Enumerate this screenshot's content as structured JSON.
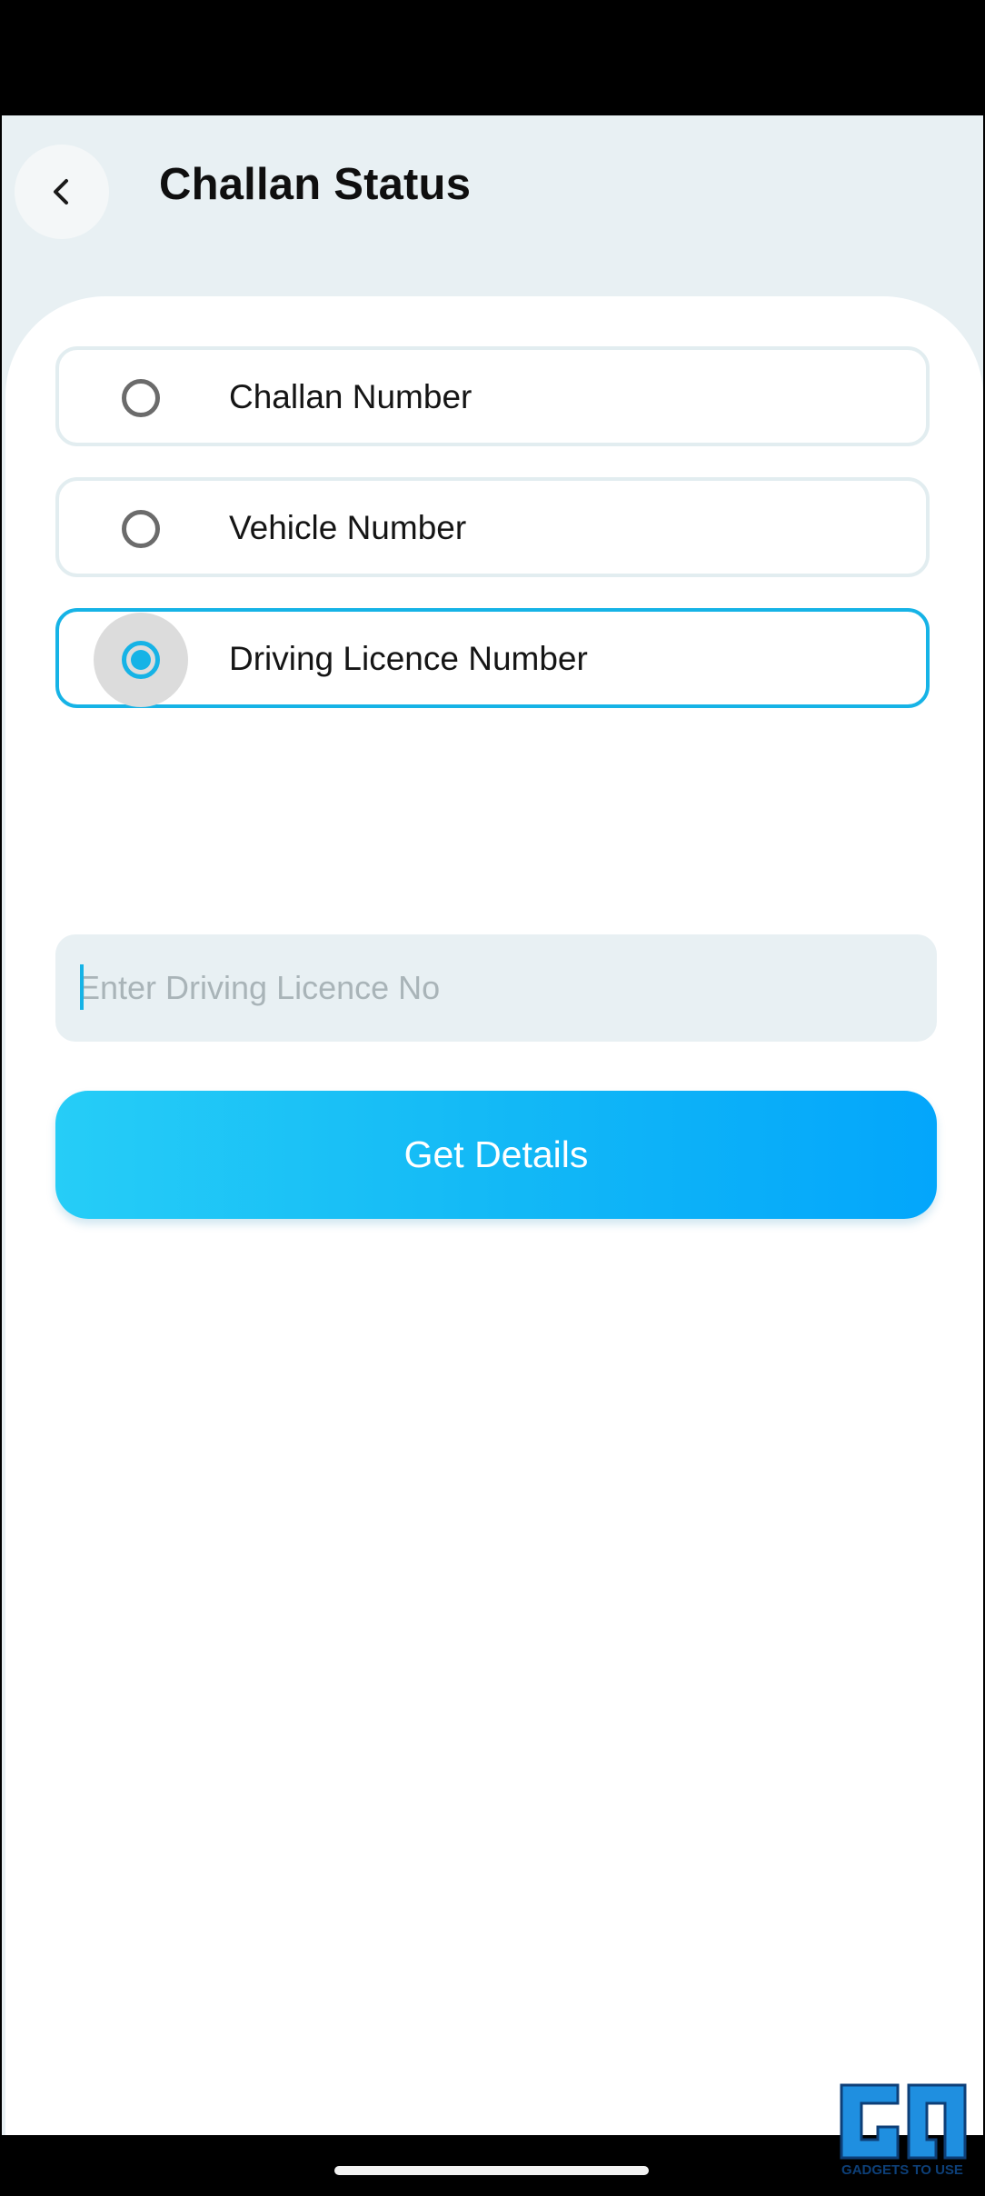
{
  "header": {
    "title": "Challan Status",
    "back_icon": "chevron-left-icon"
  },
  "search_type": {
    "options": [
      {
        "label": "Challan Number",
        "selected": false
      },
      {
        "label": "Vehicle Number",
        "selected": false
      },
      {
        "label": "Driving Licence Number",
        "selected": true
      }
    ]
  },
  "input": {
    "placeholder": "Enter Driving Licence No",
    "value": ""
  },
  "actions": {
    "get_details_label": "Get Details"
  },
  "watermark": {
    "text": "GADGETS TO USE"
  },
  "colors": {
    "accent": "#16b3e6",
    "button_gradient_start": "#26cdf7",
    "button_gradient_end": "#03a6fb",
    "header_bg": "#e8f0f3"
  }
}
